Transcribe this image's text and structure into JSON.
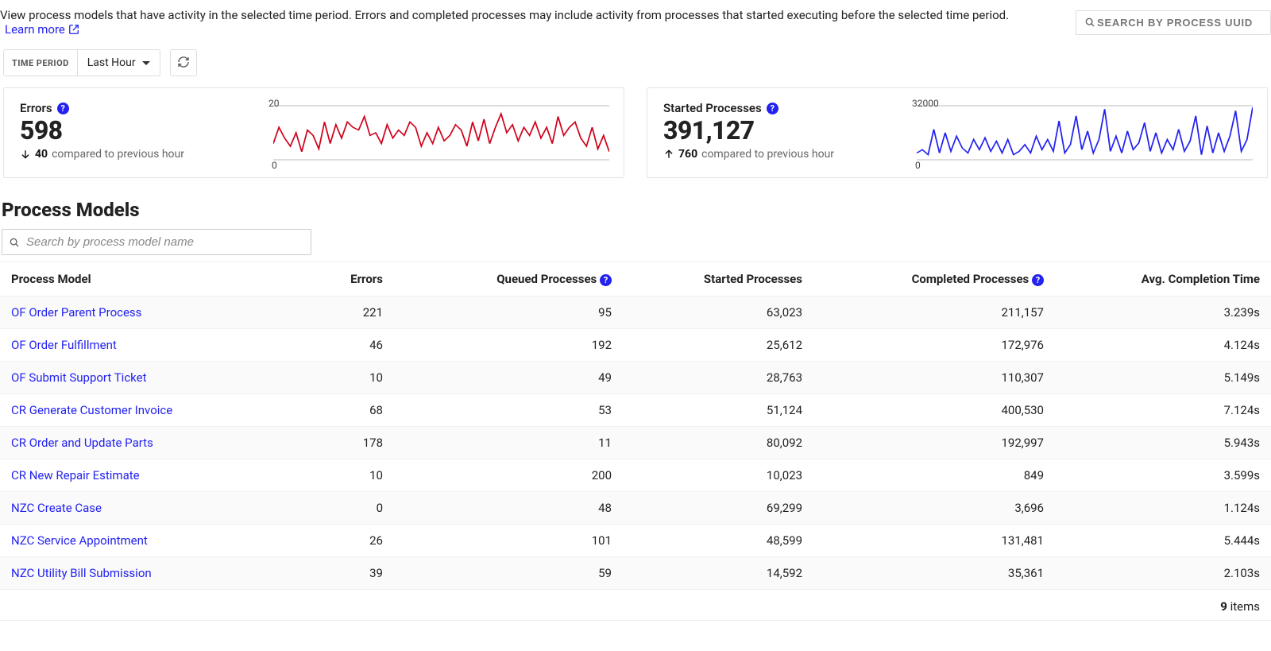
{
  "intro": {
    "text": "View process models that have activity in the selected time period. Errors and completed processes may include activity from processes that started executing before the selected time period.",
    "learn_more": "Learn more"
  },
  "search_uuid": {
    "placeholder": "SEARCH BY PROCESS UUID"
  },
  "time_period": {
    "label": "TIME PERIOD",
    "value": "Last Hour"
  },
  "cards": {
    "errors": {
      "title": "Errors",
      "value": "598",
      "delta": "40",
      "delta_dir": "down",
      "compare_text": "compared to previous hour"
    },
    "started": {
      "title": "Started Processes",
      "value": "391,127",
      "delta": "760",
      "delta_dir": "up",
      "compare_text": "compared to previous hour"
    }
  },
  "chart_data": [
    {
      "type": "line",
      "title": "Errors",
      "ylim": [
        0,
        20
      ],
      "xlabel": "",
      "ylabel": "",
      "color": "#d0021b",
      "values": [
        6,
        12,
        8,
        5,
        10,
        3,
        11,
        9,
        4,
        14,
        6,
        13,
        8,
        14,
        12,
        11,
        16,
        9,
        10,
        6,
        13,
        8,
        11,
        9,
        14,
        12,
        5,
        10,
        6,
        12,
        7,
        9,
        13,
        11,
        5,
        14,
        7,
        15,
        6,
        12,
        17,
        10,
        13,
        7,
        12,
        9,
        14,
        8,
        12,
        6,
        16,
        9,
        12,
        14,
        8,
        5,
        12,
        4,
        9,
        3
      ]
    },
    {
      "type": "line",
      "title": "Started Processes",
      "ylim": [
        0,
        32000
      ],
      "xlabel": "",
      "ylabel": "",
      "color": "#2322f0",
      "values": [
        4000,
        6000,
        3000,
        18000,
        4000,
        16000,
        5000,
        14000,
        7000,
        4000,
        12000,
        6000,
        13000,
        5000,
        11000,
        4000,
        12000,
        3000,
        5000,
        9000,
        4000,
        14000,
        6000,
        12000,
        5000,
        23000,
        4000,
        9000,
        26000,
        6000,
        17000,
        4000,
        12000,
        30000,
        5000,
        14000,
        4000,
        17000,
        6000,
        10000,
        22000,
        5000,
        16000,
        4000,
        12000,
        6000,
        18000,
        5000,
        11000,
        26000,
        3000,
        20000,
        4000,
        16000,
        5000,
        14000,
        29000,
        5000,
        12000,
        31000
      ]
    }
  ],
  "section_title": "Process Models",
  "search_pm": {
    "placeholder": "Search by process model name"
  },
  "table": {
    "headers": {
      "name": "Process Model",
      "errors": "Errors",
      "queued": "Queued Processes",
      "started": "Started Processes",
      "completed": "Completed Processes",
      "avg": "Avg. Completion Time"
    },
    "rows": [
      {
        "name": "OF Order Parent Process",
        "errors": "221",
        "queued": "95",
        "started": "63,023",
        "completed": "211,157",
        "avg": "3.239s"
      },
      {
        "name": "OF Order Fulfillment",
        "errors": "46",
        "queued": "192",
        "started": "25,612",
        "completed": "172,976",
        "avg": "4.124s"
      },
      {
        "name": "OF Submit Support Ticket",
        "errors": "10",
        "queued": "49",
        "started": "28,763",
        "completed": "110,307",
        "avg": "5.149s"
      },
      {
        "name": "CR Generate Customer Invoice",
        "errors": "68",
        "queued": "53",
        "started": "51,124",
        "completed": "400,530",
        "avg": "7.124s"
      },
      {
        "name": "CR Order and Update Parts",
        "errors": "178",
        "queued": "11",
        "started": "80,092",
        "completed": "192,997",
        "avg": "5.943s"
      },
      {
        "name": "CR New Repair Estimate",
        "errors": "10",
        "queued": "200",
        "started": "10,023",
        "completed": "849",
        "avg": "3.599s"
      },
      {
        "name": "NZC Create Case",
        "errors": "0",
        "queued": "48",
        "started": "69,299",
        "completed": "3,696",
        "avg": "1.124s"
      },
      {
        "name": "NZC Service Appointment",
        "errors": "26",
        "queued": "101",
        "started": "48,599",
        "completed": "131,481",
        "avg": "5.444s"
      },
      {
        "name": "NZC Utility Bill Submission",
        "errors": "39",
        "queued": "59",
        "started": "14,592",
        "completed": "35,361",
        "avg": "2.103s"
      }
    ],
    "footer": {
      "count": "9",
      "label": "items"
    }
  }
}
